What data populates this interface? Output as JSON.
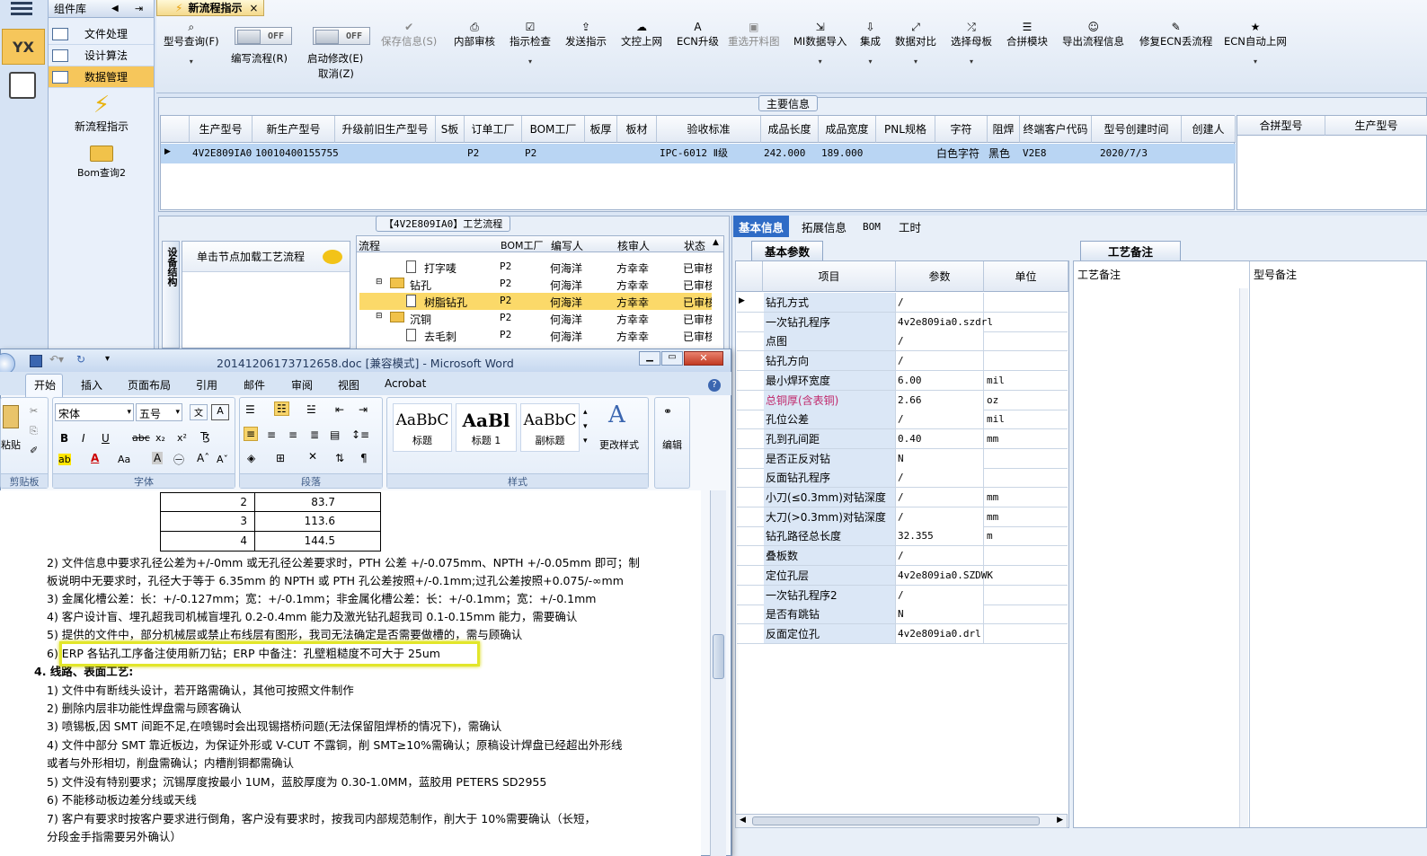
{
  "left_rail": {
    "logo": "YX"
  },
  "library": {
    "title": "组件库",
    "items": [
      {
        "label": "文件处理"
      },
      {
        "label": "设计算法"
      },
      {
        "label": "数据管理"
      }
    ],
    "launchers": [
      {
        "label": "新流程指示"
      },
      {
        "label": "Bom查询2"
      }
    ]
  },
  "app_tab": {
    "label": "新流程指示",
    "close": "×"
  },
  "toolbar": {
    "buttons": [
      {
        "label": "型号查询(F)",
        "icon": "search-icon"
      },
      {
        "label": "编写流程(R)",
        "toggle": "OFF"
      },
      {
        "label": "启动修改(E)",
        "toggle": "OFF",
        "sub": "取消(Z)"
      },
      {
        "label": "保存信息(S)",
        "icon": "check-icon"
      },
      {
        "label": "内部审核",
        "icon": "print-icon"
      },
      {
        "label": "指示检查",
        "icon": "checkbox-icon"
      },
      {
        "label": "发送指示",
        "icon": "upload-icon"
      },
      {
        "label": "文控上网",
        "icon": "cloud-upload-icon"
      },
      {
        "label": "ECN升级",
        "icon": "text-icon"
      },
      {
        "label": "重选开料图",
        "icon": "image-icon"
      },
      {
        "label": "MI数据导入",
        "icon": "import-icon"
      },
      {
        "label": "集成",
        "icon": "download-icon"
      },
      {
        "label": "数据对比",
        "icon": "compare-icon"
      },
      {
        "label": "选择母板",
        "icon": "shuffle-icon"
      },
      {
        "label": "合拼模块",
        "icon": "list-icon"
      },
      {
        "label": "导出流程信息",
        "icon": "smile-icon"
      },
      {
        "label": "修复ECN丢流程",
        "icon": "wrench-icon"
      },
      {
        "label": "ECN自动上网",
        "icon": "star-icon"
      }
    ]
  },
  "main_info": {
    "title": "主要信息",
    "columns": [
      "生产型号",
      "新生产型号",
      "升级前旧生产型号",
      "S板",
      "订单工厂",
      "BOM工厂",
      "板厚",
      "板材",
      "验收标准",
      "成品长度",
      "成品宽度",
      "PNL规格",
      "字符",
      "阻焊",
      "终端客户代码",
      "型号创建时间",
      "创建人"
    ],
    "row": [
      "4V2E809IA0",
      "10010400155755",
      "",
      "",
      "P2",
      "P2",
      "",
      "",
      "IPC-6012 Ⅱ级",
      "242.000",
      "189.000",
      "",
      "白色字符",
      "黑色",
      "V2E8",
      "2020/7/3",
      ""
    ],
    "side_columns": [
      "合拼型号",
      "生产型号"
    ]
  },
  "process": {
    "title": "【4V2E809IA0】工艺流程",
    "hint": "单击节点加载工艺流程",
    "vtab": "设备结构",
    "columns": [
      "流程",
      "BOM工厂",
      "编写人",
      "核审人",
      "状态"
    ],
    "rows": [
      {
        "name": "打字唛",
        "factory": "P2",
        "writer": "何海洋",
        "auditor": "方幸幸",
        "status": "已审核",
        "level": 2
      },
      {
        "name": "钻孔",
        "factory": "P2",
        "writer": "何海洋",
        "auditor": "方幸幸",
        "status": "已审核",
        "level": 1
      },
      {
        "name": "树脂钻孔",
        "factory": "P2",
        "writer": "何海洋",
        "auditor": "方幸幸",
        "status": "已审核",
        "level": 2,
        "selected": true
      },
      {
        "name": "沉铜",
        "factory": "P2",
        "writer": "何海洋",
        "auditor": "方幸幸",
        "status": "已审核",
        "level": 1
      },
      {
        "name": "去毛刺",
        "factory": "P2",
        "writer": "何海洋",
        "auditor": "方幸幸",
        "status": "已审核",
        "level": 2
      }
    ]
  },
  "right_tabs": [
    "基本信息",
    "拓展信息",
    "BOM",
    "工时"
  ],
  "basic_params": {
    "title": "基本参数",
    "columns": [
      "项目",
      "参数",
      "单位"
    ],
    "rows": [
      {
        "k": "钻孔方式",
        "v": "/",
        "u": ""
      },
      {
        "k": "一次钻孔程序",
        "v": "4v2e809ia0.szdrl",
        "u": ""
      },
      {
        "k": "点图",
        "v": "/",
        "u": ""
      },
      {
        "k": "钻孔方向",
        "v": "/",
        "u": ""
      },
      {
        "k": "最小焊环宽度",
        "v": "6.00",
        "u": "mil"
      },
      {
        "k": "总铜厚(含表铜)",
        "v": "2.66",
        "u": "oz",
        "red": true
      },
      {
        "k": "孔位公差",
        "v": "/",
        "u": "mil"
      },
      {
        "k": "孔到孔间距",
        "v": "0.40",
        "u": "mm"
      },
      {
        "k": "是否正反对钻",
        "v": "N",
        "u": ""
      },
      {
        "k": "反面钻孔程序",
        "v": "/",
        "u": ""
      },
      {
        "k": "小刀(≤0.3mm)对钻深度",
        "v": "/",
        "u": "mm"
      },
      {
        "k": "大刀(>0.3mm)对钻深度",
        "v": "/",
        "u": "mm"
      },
      {
        "k": "钻孔路径总长度",
        "v": "32.355",
        "u": "m"
      },
      {
        "k": "叠板数",
        "v": "/",
        "u": ""
      },
      {
        "k": "定位孔层",
        "v": "4v2e809ia0.SZDWK",
        "u": ""
      },
      {
        "k": "一次钻孔程序2",
        "v": "/",
        "u": ""
      },
      {
        "k": "是否有跳钻",
        "v": "N",
        "u": ""
      },
      {
        "k": "反面定位孔",
        "v": "4v2e809ia0.drl",
        "u": ""
      }
    ]
  },
  "remarks": {
    "title": "工艺备注",
    "columns": [
      "工艺备注",
      "型号备注"
    ]
  },
  "word": {
    "title": "20141206173712658.doc [兼容模式] - Microsoft Word",
    "tabs": [
      "开始",
      "插入",
      "页面布局",
      "引用",
      "邮件",
      "审阅",
      "视图",
      "Acrobat"
    ],
    "font_name": "宋体",
    "font_size": "五号",
    "groups": {
      "clipboard": "剪贴板",
      "font": "字体",
      "paragraph": "段落",
      "styles": "样式",
      "paste": "粘贴",
      "change_styles": "更改样式",
      "edit": "编辑"
    },
    "styles": [
      {
        "sample": "AaBbC",
        "name": "标题"
      },
      {
        "sample": "AaBl",
        "name": "标题 1"
      },
      {
        "sample": "AaBbC",
        "name": "副标题"
      }
    ],
    "table_rows": [
      {
        "n": "2",
        "v": "83.7"
      },
      {
        "n": "3",
        "v": "113.6"
      },
      {
        "n": "4",
        "v": "144.5"
      }
    ],
    "lines": [
      "2)  文件信息中要求孔径公差为+/-0mm 或无孔径公差要求时，PTH 公差 +/-0.075mm、NPTH +/-0.05mm 即可；制",
      "     板说明中无要求时，孔径大于等于 6.35mm 的 NPTH 或 PTH 孔公差按照+/-0.1mm;过孔公差按照+0.075/-∞mm",
      "3)  金属化槽公差：长：+/-0.127mm；宽：+/-0.1mm；非金属化槽公差：长：+/-0.1mm；宽：+/-0.1mm",
      "4)  客户设计盲、埋孔超我司机械盲埋孔 0.2-0.4mm 能力及激光钻孔超我司 0.1-0.15mm 能力，需要确认",
      "5)  提供的文件中，部分机械层或禁止布线层有图形，我司无法确定是否需要做槽的，需与顾确认",
      "6)  ERP 各钻孔工序备注使用新刀钻；ERP 中备注：孔壁粗糙度不可大于 25um",
      "4.   线路、表面工艺:",
      "1)  文件中有断线头设计，若开路需确认，其他可按照文件制作",
      "2)  删除内层非功能性焊盘需与顾客确认",
      "3)  喷锡板,因 SMT 间距不足,在喷锡时会出现锡搭桥问题(无法保留阻焊桥的情况下)，需确认",
      "4)  文件中部分 SMT 靠近板边，为保证外形或 V-CUT 不露铜，削 SMT≥10%需确认；原稿设计焊盘已经超出外形线",
      "     或者与外形相切，削盘需确认；内槽削铜都需确认",
      "5)  文件没有特别要求；沉锡厚度按最小 1UM，蓝胶厚度为 0.30-1.0MM，蓝胶用 PETERS   SD2955",
      "6)  不能移动板边差分线或天线",
      "7)  客户有要求时按客户要求进行倒角，客户没有要求时，按我司内部规范制作，削大于 10%需要确认（长短，",
      "     分段金手指需要另外确认）"
    ]
  }
}
